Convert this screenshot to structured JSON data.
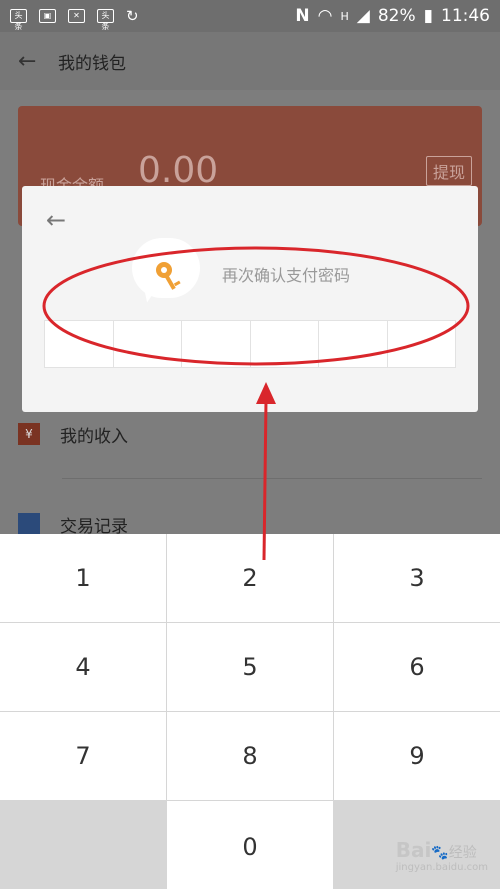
{
  "status_bar": {
    "icons": [
      "toutiao-icon",
      "image-icon",
      "mail-icon",
      "toutiao-icon",
      "refresh-icon"
    ],
    "icon_text": "头条",
    "right_icons": [
      "nfc-icon",
      "wifi-icon",
      "signal-icon"
    ],
    "h_label": "H",
    "battery": "82%",
    "time": "11:46"
  },
  "header": {
    "title": "我的钱包"
  },
  "wallet": {
    "balance_label": "现金余额",
    "balance_value": "0.00",
    "withdraw_label": "提现"
  },
  "menu": [
    {
      "icon": "income-icon",
      "label": "我的收入"
    },
    {
      "icon": "clipboard-icon",
      "label": "交易记录"
    }
  ],
  "dialog": {
    "prompt": "再次确认支付密码",
    "digits": 6
  },
  "keypad": {
    "keys": [
      "1",
      "2",
      "3",
      "4",
      "5",
      "6",
      "7",
      "8",
      "9",
      "",
      "0",
      ""
    ]
  },
  "watermark": {
    "brand": "Bai",
    "brand_cn": "经验",
    "url": "jingyan.baidu.com"
  },
  "colors": {
    "wallet_card": "#8a4a3b",
    "annotation_red": "#d9262b"
  }
}
